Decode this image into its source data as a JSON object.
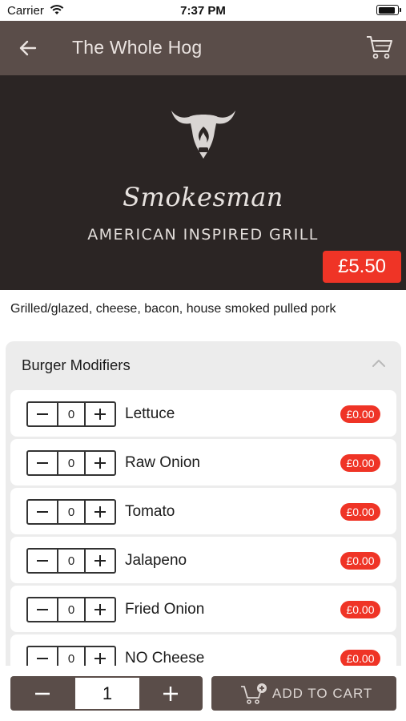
{
  "status_bar": {
    "carrier": "Carrier",
    "time": "7:37 PM",
    "battery_level": 0.95
  },
  "nav": {
    "title": "The Whole Hog",
    "back_icon": "arrow-left-icon",
    "cart_icon": "shopping-cart-icon"
  },
  "hero": {
    "brand_script": "Smokesman",
    "brand_sub": "AMERICAN INSPIRED GRILL",
    "logo_icon": "bull-head-flame-logo",
    "price": "£5.50"
  },
  "item": {
    "description": "Grilled/glazed, cheese, bacon, house smoked pulled pork"
  },
  "modifiers": {
    "title": "Burger Modifiers",
    "expanded": true,
    "items": [
      {
        "label": "Lettuce",
        "quantity": "0",
        "price": "£0.00"
      },
      {
        "label": "Raw Onion",
        "quantity": "0",
        "price": "£0.00"
      },
      {
        "label": "Tomato",
        "quantity": "0",
        "price": "£0.00"
      },
      {
        "label": "Jalapeno",
        "quantity": "0",
        "price": "£0.00"
      },
      {
        "label": "Fried Onion",
        "quantity": "0",
        "price": "£0.00"
      },
      {
        "label": "NO Cheese",
        "quantity": "0",
        "price": "£0.00"
      }
    ]
  },
  "bottom": {
    "quantity": "1",
    "add_to_cart_label": "ADD TO CART"
  },
  "colors": {
    "bar_brown": "#5a4d49",
    "hero_dark": "#2b2524",
    "accent_red": "#ef3426",
    "panel_grey": "#ececec"
  }
}
